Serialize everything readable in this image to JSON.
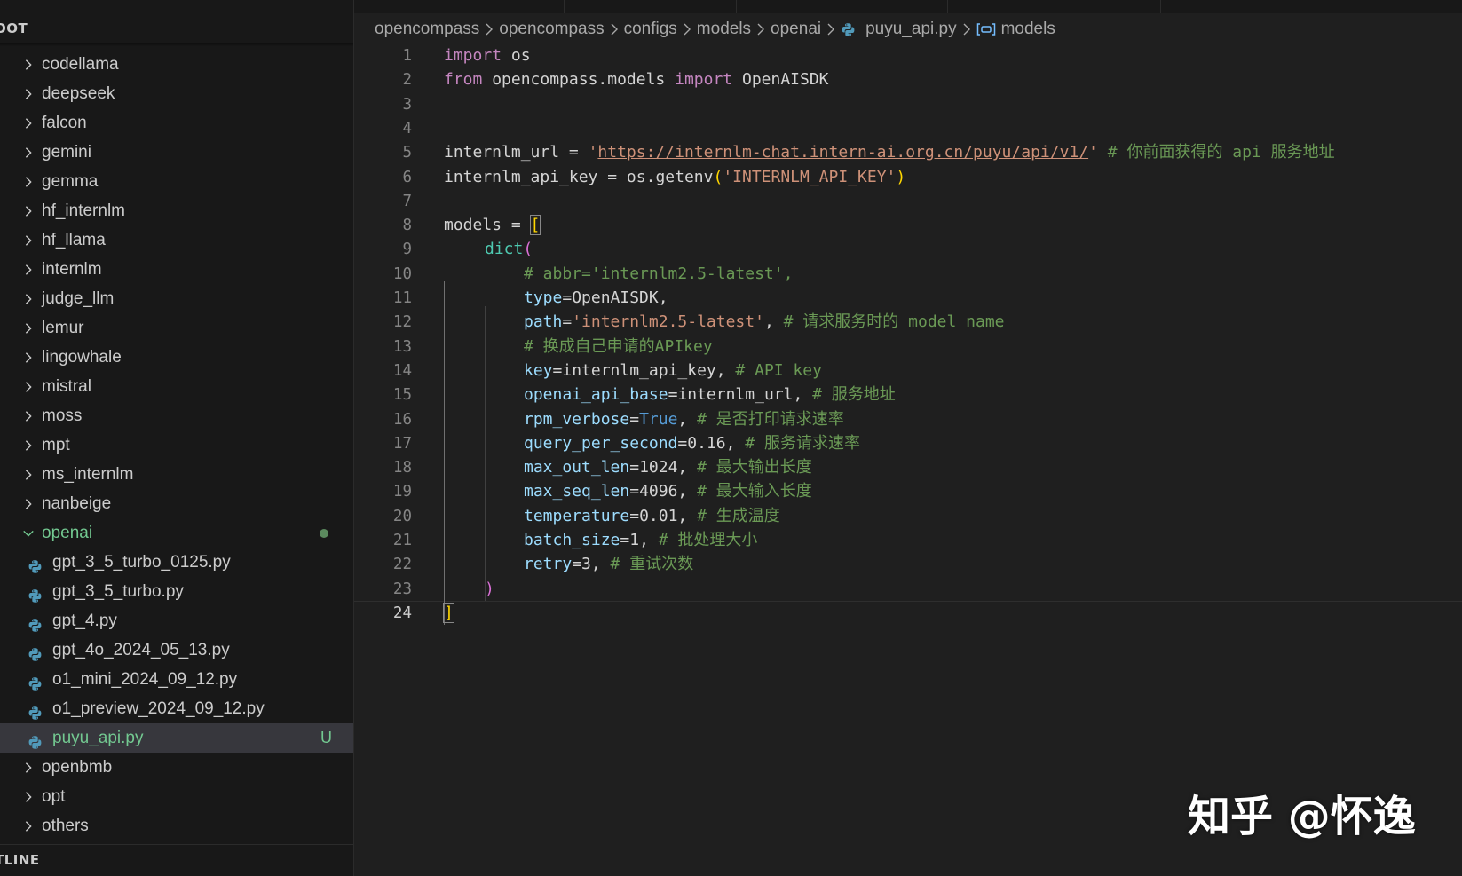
{
  "colors": {
    "background": "#1f1f1f",
    "sidebar": "#181818",
    "selection": "#37373d",
    "git_untracked": "#73c991",
    "keyword": "#c586c0",
    "variable": "#9cdcfe",
    "function": "#dcdcaa",
    "string": "#ce9178",
    "comment": "#6a9955",
    "number": "#b5cea8",
    "boolean": "#569cd6",
    "python_icon": "#519aba"
  },
  "sidebar": {
    "explorer_header": "OOT",
    "outline_header": "TLINE",
    "folders_before": [
      {
        "label": "codellama",
        "icon": "chevron-right-icon"
      },
      {
        "label": "deepseek",
        "icon": "chevron-right-icon"
      },
      {
        "label": "falcon",
        "icon": "chevron-right-icon"
      },
      {
        "label": "gemini",
        "icon": "chevron-right-icon"
      },
      {
        "label": "gemma",
        "icon": "chevron-right-icon"
      },
      {
        "label": "hf_internlm",
        "icon": "chevron-right-icon"
      },
      {
        "label": "hf_llama",
        "icon": "chevron-right-icon"
      },
      {
        "label": "internlm",
        "icon": "chevron-right-icon"
      },
      {
        "label": "judge_llm",
        "icon": "chevron-right-icon"
      },
      {
        "label": "lemur",
        "icon": "chevron-right-icon"
      },
      {
        "label": "lingowhale",
        "icon": "chevron-right-icon"
      },
      {
        "label": "mistral",
        "icon": "chevron-right-icon"
      },
      {
        "label": "moss",
        "icon": "chevron-right-icon"
      },
      {
        "label": "mpt",
        "icon": "chevron-right-icon"
      },
      {
        "label": "ms_internlm",
        "icon": "chevron-right-icon"
      },
      {
        "label": "nanbeige",
        "icon": "chevron-right-icon"
      }
    ],
    "open_folder": {
      "label": "openai",
      "icon": "chevron-down-icon"
    },
    "files": [
      {
        "label": "gpt_3_5_turbo_0125.py",
        "icon": "python-file-icon"
      },
      {
        "label": "gpt_3_5_turbo.py",
        "icon": "python-file-icon"
      },
      {
        "label": "gpt_4.py",
        "icon": "python-file-icon"
      },
      {
        "label": "gpt_4o_2024_05_13.py",
        "icon": "python-file-icon"
      },
      {
        "label": "o1_mini_2024_09_12.py",
        "icon": "python-file-icon"
      },
      {
        "label": "o1_preview_2024_09_12.py",
        "icon": "python-file-icon"
      },
      {
        "label": "puyu_api.py",
        "icon": "python-file-icon",
        "selected": true,
        "badge": "U"
      }
    ],
    "folders_after": [
      {
        "label": "openbmb",
        "icon": "chevron-right-icon"
      },
      {
        "label": "opt",
        "icon": "chevron-right-icon"
      },
      {
        "label": "others",
        "icon": "chevron-right-icon"
      }
    ]
  },
  "breadcrumb": {
    "items": [
      "opencompass",
      "opencompass",
      "configs",
      "models",
      "openai"
    ],
    "file": "puyu_api.py",
    "symbol": "models"
  },
  "editor": {
    "active_line": "24",
    "line_numbers": [
      "1",
      "2",
      "3",
      "4",
      "5",
      "6",
      "7",
      "8",
      "9",
      "10",
      "11",
      "12",
      "13",
      "14",
      "15",
      "16",
      "17",
      "18",
      "19",
      "20",
      "21",
      "22",
      "23",
      "24"
    ],
    "code": {
      "l1_kw": "import",
      "l1_mod": " os",
      "l2_kw": "from",
      "l2_mod": " opencompass.models ",
      "l2_kw2": "import",
      "l2_cls": " OpenAISDK",
      "l5_var": "internlm_url",
      "l5_eq": " = ",
      "l5_q1": "'",
      "l5_url": "https://internlm-chat.intern-ai.org.cn/puyu/api/v1/",
      "l5_q2": "'",
      "l5_cm": " # 你前面获得的 api 服务地址",
      "l6_var": "internlm_api_key",
      "l6_eq": " = ",
      "l6_obj": "os",
      "l6_dot": ".",
      "l6_fn": "getenv",
      "l6_p1": "(",
      "l6_str": "'INTERNLM_API_KEY'",
      "l6_p2": ")",
      "l8_var": "models",
      "l8_eq": " = ",
      "l8_br": "[",
      "l9_fn": "dict",
      "l9_br": "(",
      "l10_cm": "# abbr='internlm2.5-latest',",
      "l11_key": "type",
      "l11_eq": "=",
      "l11_val": "OpenAISDK",
      "l11_comma": ",",
      "l12_key": "path",
      "l12_eq": "=",
      "l12_str": "'internlm2.5-latest'",
      "l12_comma": ",",
      "l12_cm": " # 请求服务时的 model name",
      "l13_cm": "# 换成自己申请的APIkey",
      "l14_key": "key",
      "l14_eq": "=",
      "l14_val": "internlm_api_key",
      "l14_comma": ",",
      "l14_cm": " # API key",
      "l15_key": "openai_api_base",
      "l15_eq": "=",
      "l15_val": "internlm_url",
      "l15_comma": ",",
      "l15_cm": " # 服务地址",
      "l16_key": "rpm_verbose",
      "l16_eq": "=",
      "l16_val": "True",
      "l16_comma": ",",
      "l16_cm": " # 是否打印请求速率",
      "l17_key": "query_per_second",
      "l17_eq": "=",
      "l17_val": "0.16",
      "l17_comma": ",",
      "l17_cm": " # 服务请求速率",
      "l18_key": "max_out_len",
      "l18_eq": "=",
      "l18_val": "1024",
      "l18_comma": ",",
      "l18_cm": " # 最大输出长度",
      "l19_key": "max_seq_len",
      "l19_eq": "=",
      "l19_val": "4096",
      "l19_comma": ",",
      "l19_cm": " # 最大输入长度",
      "l20_key": "temperature",
      "l20_eq": "=",
      "l20_val": "0.01",
      "l20_comma": ",",
      "l20_cm": " # 生成温度",
      "l21_key": "batch_size",
      "l21_eq": "=",
      "l21_val": "1",
      "l21_comma": ",",
      "l21_cm": " # 批处理大小",
      "l22_key": "retry",
      "l22_eq": "=",
      "l22_val": "3",
      "l22_comma": ",",
      "l22_cm": " # 重试次数",
      "l23_br": ")",
      "l24_br": "]"
    }
  },
  "watermark": "知乎 @怀逸"
}
